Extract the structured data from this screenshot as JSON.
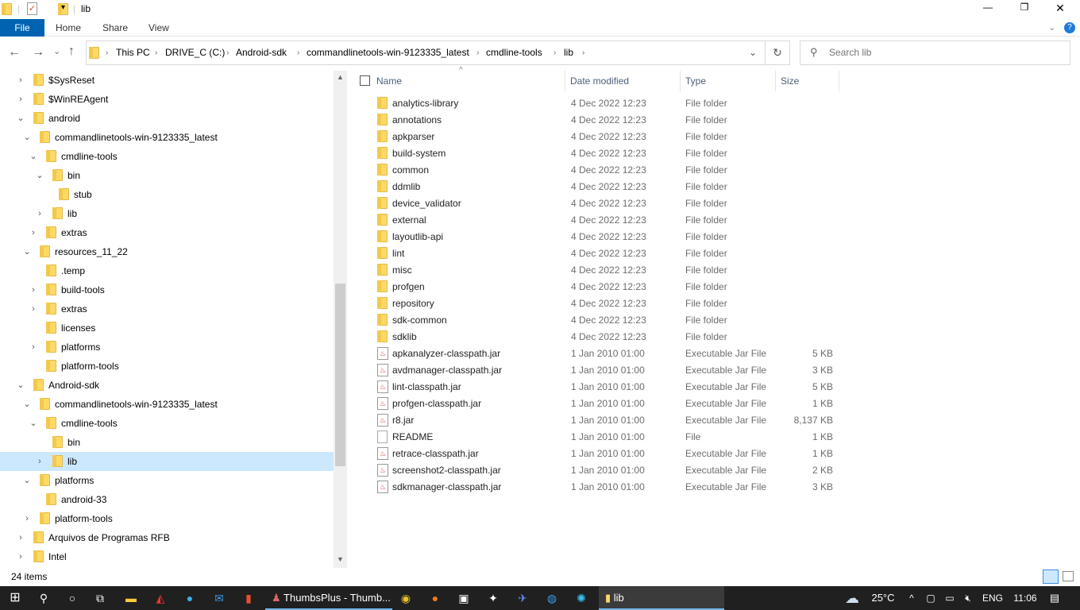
{
  "window": {
    "title": "lib",
    "minimize": "—",
    "maximize": "❐",
    "close": "✕"
  },
  "ribbon": {
    "tabs": [
      "File",
      "Home",
      "Share",
      "View"
    ]
  },
  "nav": {
    "back": "←",
    "forward": "→",
    "recent": "⌄",
    "up": "↑",
    "refresh": "↻",
    "dropdown": "⌄"
  },
  "breadcrumb": [
    "This PC",
    "DRIVE_C (C:)",
    "Android-sdk",
    "commandlinetools-win-9123335_latest",
    "cmdline-tools",
    "lib"
  ],
  "search": {
    "placeholder": "Search lib"
  },
  "tree": [
    {
      "label": "$SysReset",
      "level": 0,
      "exp": "closed"
    },
    {
      "label": "$WinREAgent",
      "level": 0,
      "exp": "closed"
    },
    {
      "label": "android",
      "level": 0,
      "exp": "open"
    },
    {
      "label": "commandlinetools-win-9123335_latest",
      "level": 1,
      "exp": "open"
    },
    {
      "label": "cmdline-tools",
      "level": 2,
      "exp": "open"
    },
    {
      "label": "bin",
      "level": 3,
      "exp": "open"
    },
    {
      "label": "stub",
      "level": 4,
      "exp": "none"
    },
    {
      "label": "lib",
      "level": 3,
      "exp": "closed"
    },
    {
      "label": "extras",
      "level": 2,
      "exp": "closed"
    },
    {
      "label": "resources_11_22",
      "level": 1,
      "exp": "open"
    },
    {
      "label": ".temp",
      "level": 2,
      "exp": "none"
    },
    {
      "label": "build-tools",
      "level": 2,
      "exp": "closed"
    },
    {
      "label": "extras",
      "level": 2,
      "exp": "closed"
    },
    {
      "label": "licenses",
      "level": 2,
      "exp": "none"
    },
    {
      "label": "platforms",
      "level": 2,
      "exp": "closed"
    },
    {
      "label": "platform-tools",
      "level": 2,
      "exp": "none"
    },
    {
      "label": "Android-sdk",
      "level": 0,
      "exp": "open"
    },
    {
      "label": "commandlinetools-win-9123335_latest",
      "level": 1,
      "exp": "open"
    },
    {
      "label": "cmdline-tools",
      "level": 2,
      "exp": "open"
    },
    {
      "label": "bin",
      "level": 3,
      "exp": "none"
    },
    {
      "label": "lib",
      "level": 3,
      "exp": "closed",
      "selected": true
    },
    {
      "label": "platforms",
      "level": 1,
      "exp": "open"
    },
    {
      "label": "android-33",
      "level": 2,
      "exp": "none"
    },
    {
      "label": "platform-tools",
      "level": 1,
      "exp": "closed"
    },
    {
      "label": "Arquivos de Programas RFB",
      "level": 0,
      "exp": "closed"
    },
    {
      "label": "Intel",
      "level": 0,
      "exp": "closed"
    }
  ],
  "columns": {
    "name": "Name",
    "date": "Date modified",
    "type": "Type",
    "size": "Size"
  },
  "files": [
    {
      "name": "analytics-library",
      "date": "4 Dec 2022 12:23",
      "type": "File folder",
      "size": "",
      "kind": "folder"
    },
    {
      "name": "annotations",
      "date": "4 Dec 2022 12:23",
      "type": "File folder",
      "size": "",
      "kind": "folder"
    },
    {
      "name": "apkparser",
      "date": "4 Dec 2022 12:23",
      "type": "File folder",
      "size": "",
      "kind": "folder"
    },
    {
      "name": "build-system",
      "date": "4 Dec 2022 12:23",
      "type": "File folder",
      "size": "",
      "kind": "folder"
    },
    {
      "name": "common",
      "date": "4 Dec 2022 12:23",
      "type": "File folder",
      "size": "",
      "kind": "folder"
    },
    {
      "name": "ddmlib",
      "date": "4 Dec 2022 12:23",
      "type": "File folder",
      "size": "",
      "kind": "folder"
    },
    {
      "name": "device_validator",
      "date": "4 Dec 2022 12:23",
      "type": "File folder",
      "size": "",
      "kind": "folder"
    },
    {
      "name": "external",
      "date": "4 Dec 2022 12:23",
      "type": "File folder",
      "size": "",
      "kind": "folder"
    },
    {
      "name": "layoutlib-api",
      "date": "4 Dec 2022 12:23",
      "type": "File folder",
      "size": "",
      "kind": "folder"
    },
    {
      "name": "lint",
      "date": "4 Dec 2022 12:23",
      "type": "File folder",
      "size": "",
      "kind": "folder"
    },
    {
      "name": "misc",
      "date": "4 Dec 2022 12:23",
      "type": "File folder",
      "size": "",
      "kind": "folder"
    },
    {
      "name": "profgen",
      "date": "4 Dec 2022 12:23",
      "type": "File folder",
      "size": "",
      "kind": "folder"
    },
    {
      "name": "repository",
      "date": "4 Dec 2022 12:23",
      "type": "File folder",
      "size": "",
      "kind": "folder"
    },
    {
      "name": "sdk-common",
      "date": "4 Dec 2022 12:23",
      "type": "File folder",
      "size": "",
      "kind": "folder"
    },
    {
      "name": "sdklib",
      "date": "4 Dec 2022 12:23",
      "type": "File folder",
      "size": "",
      "kind": "folder"
    },
    {
      "name": "apkanalyzer-classpath.jar",
      "date": "1 Jan 2010 01:00",
      "type": "Executable Jar File",
      "size": "5 KB",
      "kind": "jar"
    },
    {
      "name": "avdmanager-classpath.jar",
      "date": "1 Jan 2010 01:00",
      "type": "Executable Jar File",
      "size": "3 KB",
      "kind": "jar"
    },
    {
      "name": "lint-classpath.jar",
      "date": "1 Jan 2010 01:00",
      "type": "Executable Jar File",
      "size": "5 KB",
      "kind": "jar"
    },
    {
      "name": "profgen-classpath.jar",
      "date": "1 Jan 2010 01:00",
      "type": "Executable Jar File",
      "size": "1 KB",
      "kind": "jar"
    },
    {
      "name": "r8.jar",
      "date": "1 Jan 2010 01:00",
      "type": "Executable Jar File",
      "size": "8,137 KB",
      "kind": "jar"
    },
    {
      "name": "README",
      "date": "1 Jan 2010 01:00",
      "type": "File",
      "size": "1 KB",
      "kind": "file"
    },
    {
      "name": "retrace-classpath.jar",
      "date": "1 Jan 2010 01:00",
      "type": "Executable Jar File",
      "size": "1 KB",
      "kind": "jar"
    },
    {
      "name": "screenshot2-classpath.jar",
      "date": "1 Jan 2010 01:00",
      "type": "Executable Jar File",
      "size": "2 KB",
      "kind": "jar"
    },
    {
      "name": "sdkmanager-classpath.jar",
      "date": "1 Jan 2010 01:00",
      "type": "Executable Jar File",
      "size": "3 KB",
      "kind": "jar"
    }
  ],
  "status": {
    "count": "24 items"
  },
  "taskbar": {
    "app_label": "ThumbsPlus - Thumb...",
    "active_label": "lib",
    "weather": "25°C",
    "lang": "ENG",
    "time": "11:06"
  },
  "colors": {
    "accent": "#0063b1",
    "selected": "#cce8ff",
    "taskbar": "#202020"
  }
}
